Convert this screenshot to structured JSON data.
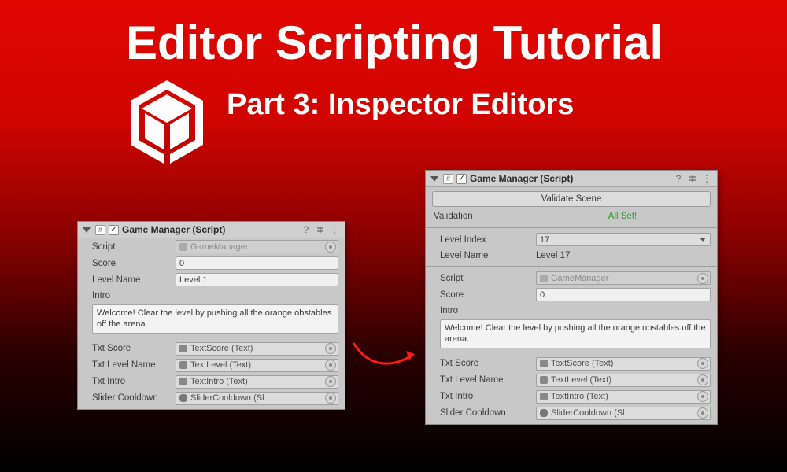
{
  "hero": {
    "title": "Editor Scripting Tutorial",
    "subtitle": "Part 3: Inspector Editors"
  },
  "left_panel": {
    "component_name": "Game Manager (Script)",
    "enabled_check": "✓",
    "script_label": "Script",
    "script_ref": "GameManager",
    "score_label": "Score",
    "score_value": "0",
    "level_name_label": "Level Name",
    "level_name_value": "Level 1",
    "intro_label": "Intro",
    "intro_text": "Welcome! Clear the level by pushing all the orange obstables off the arena.",
    "txt_score_label": "Txt Score",
    "txt_score_ref": "TextScore (Text)",
    "txt_level_label": "Txt Level Name",
    "txt_level_ref": "TextLevel (Text)",
    "txt_intro_label": "Txt Intro",
    "txt_intro_ref": "TextIntro (Text)",
    "slider_label": "Slider Cooldown",
    "slider_ref": "SliderCooldown (Sl"
  },
  "right_panel": {
    "component_name": "Game Manager (Script)",
    "enabled_check": "✓",
    "validate_button": "Validate Scene",
    "validation_label": "Validation",
    "validation_status": "All Set!",
    "level_index_label": "Level Index",
    "level_index_value": "17",
    "level_name_label": "Level Name",
    "level_name_value": "Level 17",
    "script_label": "Script",
    "script_ref": "GameManager",
    "score_label": "Score",
    "score_value": "0",
    "intro_label": "Intro",
    "intro_text": "Welcome! Clear the level by pushing all the orange obstables off the arena.",
    "txt_score_label": "Txt Score",
    "txt_score_ref": "TextScore (Text)",
    "txt_level_label": "Txt Level Name",
    "txt_level_ref": "TextLevel (Text)",
    "txt_intro_label": "Txt Intro",
    "txt_intro_ref": "TextIntro (Text)",
    "slider_label": "Slider Cooldown",
    "slider_ref": "SliderCooldown (Sl"
  }
}
